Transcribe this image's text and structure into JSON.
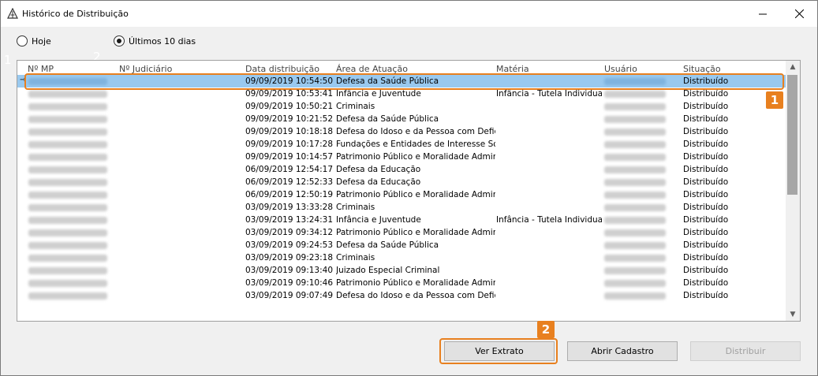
{
  "window": {
    "title": "Histórico de Distribuição"
  },
  "filters": {
    "today_label": "Hoje",
    "last10_label": "Últimos 10 dias",
    "selected": "last10"
  },
  "markers": {
    "one": "1",
    "two": "2"
  },
  "columns": {
    "mp": "Nº MP",
    "judicial": "Nº Judiciário",
    "date": "Data distribuição",
    "area": "Área de Atuação",
    "subject": "Matéria",
    "user": "Usuário",
    "status": "Situação"
  },
  "rows": [
    {
      "date": "09/09/2019 10:54:50",
      "area": "Defesa da Saúde Pública",
      "subject": "",
      "status": "Distribuído"
    },
    {
      "date": "09/09/2019 10:53:41",
      "area": "Infância e Juventude",
      "subject": "Infância - Tutela Individual",
      "status": "Distribuído"
    },
    {
      "date": "09/09/2019 10:50:21",
      "area": "Criminais",
      "subject": "",
      "status": "Distribuído"
    },
    {
      "date": "09/09/2019 10:21:52",
      "area": "Defesa da Saúde Pública",
      "subject": "",
      "status": "Distribuído"
    },
    {
      "date": "09/09/2019 10:18:18",
      "area": "Defesa do Idoso e da Pessoa com Defici",
      "subject": "",
      "status": "Distribuído"
    },
    {
      "date": "09/09/2019 10:17:28",
      "area": "Fundações e Entidades de Interesse Soc",
      "subject": "",
      "status": "Distribuído"
    },
    {
      "date": "09/09/2019 10:14:57",
      "area": "Patrimonio Público e Moralidade Admir",
      "subject": "",
      "status": "Distribuído"
    },
    {
      "date": "06/09/2019 12:54:17",
      "area": "Defesa da Educação",
      "subject": "",
      "status": "Distribuído"
    },
    {
      "date": "06/09/2019 12:52:33",
      "area": "Defesa da Educação",
      "subject": "",
      "status": "Distribuído"
    },
    {
      "date": "06/09/2019 12:50:19",
      "area": "Patrimonio Público e Moralidade Admir",
      "subject": "",
      "status": "Distribuído"
    },
    {
      "date": "03/09/2019 13:33:28",
      "area": "Criminais",
      "subject": "",
      "status": "Distribuído"
    },
    {
      "date": "03/09/2019 13:24:31",
      "area": "Infância e Juventude",
      "subject": "Infância - Tutela Individual",
      "status": "Distribuído"
    },
    {
      "date": "03/09/2019 09:34:12",
      "area": "Patrimonio Público e Moralidade Admir",
      "subject": "",
      "status": "Distribuído"
    },
    {
      "date": "03/09/2019 09:24:53",
      "area": "Defesa da Saúde Pública",
      "subject": "",
      "status": "Distribuído"
    },
    {
      "date": "03/09/2019 09:23:18",
      "area": "Criminais",
      "subject": "",
      "status": "Distribuído"
    },
    {
      "date": "03/09/2019 09:13:40",
      "area": "Juizado Especial Criminal",
      "subject": "",
      "status": "Distribuído"
    },
    {
      "date": "03/09/2019 09:10:46",
      "area": "Patrimonio Público e Moralidade Admir",
      "subject": "",
      "status": "Distribuído"
    },
    {
      "date": "03/09/2019 09:07:49",
      "area": "Defesa do Idoso e da Pessoa com Defici",
      "subject": "",
      "status": "Distribuído"
    }
  ],
  "buttons": {
    "extract": "Ver Extrato",
    "open": "Abrir Cadastro",
    "distribute": "Distribuir"
  },
  "callouts": {
    "row": "1",
    "button": "2"
  },
  "colors": {
    "accent": "#e8801f",
    "selection": "#99c9ef"
  }
}
